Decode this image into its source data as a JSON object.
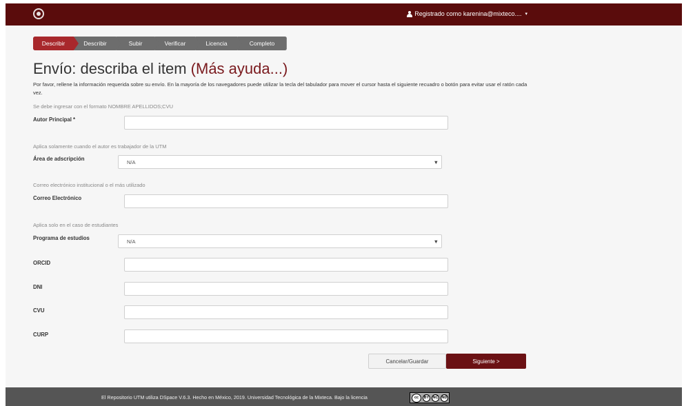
{
  "header": {
    "user_label": "Registrado como karenina@mixteco....",
    "user_caret": "▾"
  },
  "progress": {
    "steps": [
      "Describir",
      "Describir",
      "Subir",
      "Verificar",
      "Licencia",
      "Completo"
    ],
    "active_index": 0
  },
  "page": {
    "title": "Envío: describa el item",
    "help_link": "(Más ayuda...)",
    "intro": "Por favor, rellene la información requerida sobre su envío. En la mayoría de los navegadores puede utilizar la tecla del tabulador para mover el cursor hasta el siguiente recuadro o botón para evitar usar el ratón cada vez."
  },
  "form": {
    "autor": {
      "hint": "Se debe ingresar con el formato NOMBRE APELLIDOS;CVU",
      "label": "Autor Principal *",
      "value": ""
    },
    "area": {
      "hint": "Aplica solamente cuando el autor es trabajador de la UTM",
      "label": "Área de adscripción",
      "selected": "N/A",
      "arrow": "▼"
    },
    "correo": {
      "hint": "Correo electrónico institucional o el más utilizado",
      "label": "Correo Electrónico",
      "value": ""
    },
    "programa": {
      "hint": "Aplica solo en el caso de estudiantes",
      "label": "Programa de estudios",
      "selected": "N/A",
      "arrow": "▼"
    },
    "orcid": {
      "label": "ORCID",
      "value": ""
    },
    "dni": {
      "label": "DNI",
      "value": ""
    },
    "cvu": {
      "label": "CVU",
      "value": ""
    },
    "curp": {
      "label": "CURP",
      "value": ""
    }
  },
  "buttons": {
    "cancel": "Cancelar/Guardar",
    "next": "Siguiente >"
  },
  "footer": {
    "text": "El Repositorio UTM utiliza DSpace V.6.3. Hecho en México, 2019. Universidad Tecnológica de la Mixteca. Bajo la licencia",
    "license_glyphs": [
      "cc",
      "BY",
      "NC",
      "ND"
    ]
  },
  "colors": {
    "brand": "#5a0c0c",
    "active_step": "#a8282c",
    "next_button": "#6b1114",
    "footer": "#555555"
  }
}
